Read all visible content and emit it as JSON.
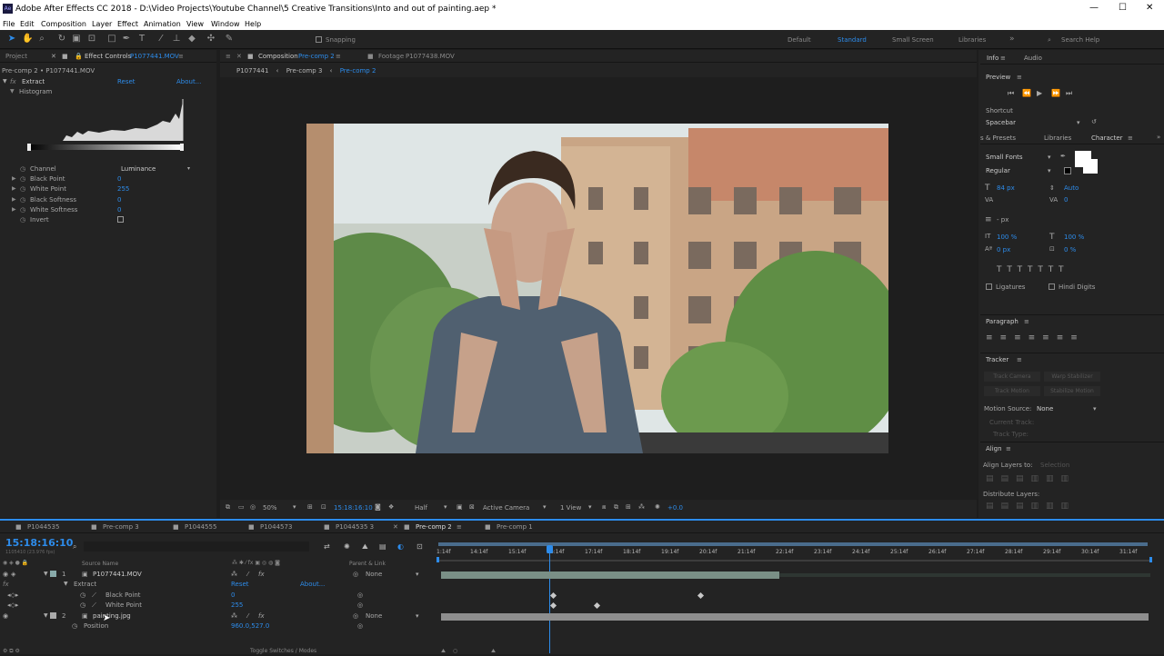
{
  "window": {
    "title": "Adobe After Effects CC 2018 - D:\\Video Projects\\Youtube Channel\\5 Creative Transitions\\Into and out of painting.aep *"
  },
  "menu": [
    "File",
    "Edit",
    "Composition",
    "Layer",
    "Effect",
    "Animation",
    "View",
    "Window",
    "Help"
  ],
  "toolbar": {
    "snapping": "Snapping",
    "workspaces": [
      "Default",
      "Standard",
      "Small Screen",
      "Libraries"
    ],
    "search_placeholder": "Search Help"
  },
  "effect_panel": {
    "tabs": [
      "Project",
      "Effect Controls",
      "P1077441.MOV"
    ],
    "layer_path": "Pre-comp 2 • P1077441.MOV",
    "effect_name": "Extract",
    "reset": "Reset",
    "about": "About...",
    "histogram": "Histogram",
    "props": [
      {
        "label": "Channel",
        "value": "Luminance"
      },
      {
        "label": "Black Point",
        "value": "0"
      },
      {
        "label": "White Point",
        "value": "255"
      },
      {
        "label": "Black Softness",
        "value": "0"
      },
      {
        "label": "White Softness",
        "value": "0"
      },
      {
        "label": "Invert",
        "value": ""
      }
    ]
  },
  "comp_panel": {
    "tabs": [
      "Composition",
      "Pre-comp 2",
      "Footage",
      "P1077438.MOV"
    ],
    "breadcrumbs": [
      "P1077441",
      "Pre-comp 3",
      "Pre-comp 2"
    ],
    "footer": {
      "zoom": "50%",
      "timecode": "15:18:16:10",
      "resolution": "Half",
      "camera": "Active Camera",
      "view": "1 View",
      "exposure": "+0.0"
    }
  },
  "right_panel": {
    "tabs": [
      "Info",
      "Audio"
    ],
    "preview": "Preview",
    "shortcut": "Shortcut",
    "spacebar": "Spacebar",
    "char_tabs": [
      "s & Presets",
      "Libraries",
      "Character"
    ],
    "font": "Small Fonts",
    "style": "Regular",
    "font_size": "84 px",
    "leading": "Auto",
    "tracking": "0",
    "stroke": "- px",
    "vscale": "100 %",
    "hscale": "100 %",
    "baseline": "0 px",
    "tsume": "0 %",
    "ligatures": "Ligatures",
    "hindi": "Hindi Digits",
    "paragraph": "Paragraph",
    "tracker": "Tracker",
    "tracker_btns": [
      "Track Camera",
      "Warp Stabilizer",
      "Track Motion",
      "Stabilize Motion"
    ],
    "motion_source_label": "Motion Source:",
    "motion_source": "None",
    "current_track": "Current Track:",
    "track_type": "Track Type:",
    "align": "Align",
    "align_to": "Align Layers to:",
    "selection": "Selection",
    "distribute": "Distribute Layers:"
  },
  "timeline": {
    "tabs": [
      "P1044535",
      "Pre-comp 3",
      "P1044555",
      "P1044573",
      "P1044535 3",
      "Pre-comp 2",
      "Pre-comp 1"
    ],
    "timecode": "15:18:16:10",
    "fps": "1105410 (23.976 fps)",
    "columns": {
      "source": "Source Name",
      "parent": "Parent & Link"
    },
    "ruler": [
      "1:14f",
      "14:14f",
      "15:14f",
      "16:14f",
      "17:14f",
      "18:14f",
      "19:14f",
      "20:14f",
      "21:14f",
      "22:14f",
      "23:14f",
      "24:14f",
      "25:14f",
      "26:14f",
      "27:14f",
      "28:14f",
      "29:14f",
      "30:14f",
      "31:14f"
    ],
    "layers": [
      {
        "num": "1",
        "name": "P1077441.MOV",
        "parent": "None"
      },
      {
        "num": "2",
        "name": "painting.jpg",
        "parent": "None"
      }
    ],
    "extract": "Extract",
    "reset": "Reset",
    "about": "About...",
    "black_point": "Black Point",
    "black_val": "0",
    "white_point": "White Point",
    "white_val": "255",
    "position": "Position",
    "position_val": "960.0,527.0",
    "toggle": "Toggle Switches / Modes"
  },
  "colors": {
    "accent": "#2d8ceb",
    "panel": "#232323"
  }
}
